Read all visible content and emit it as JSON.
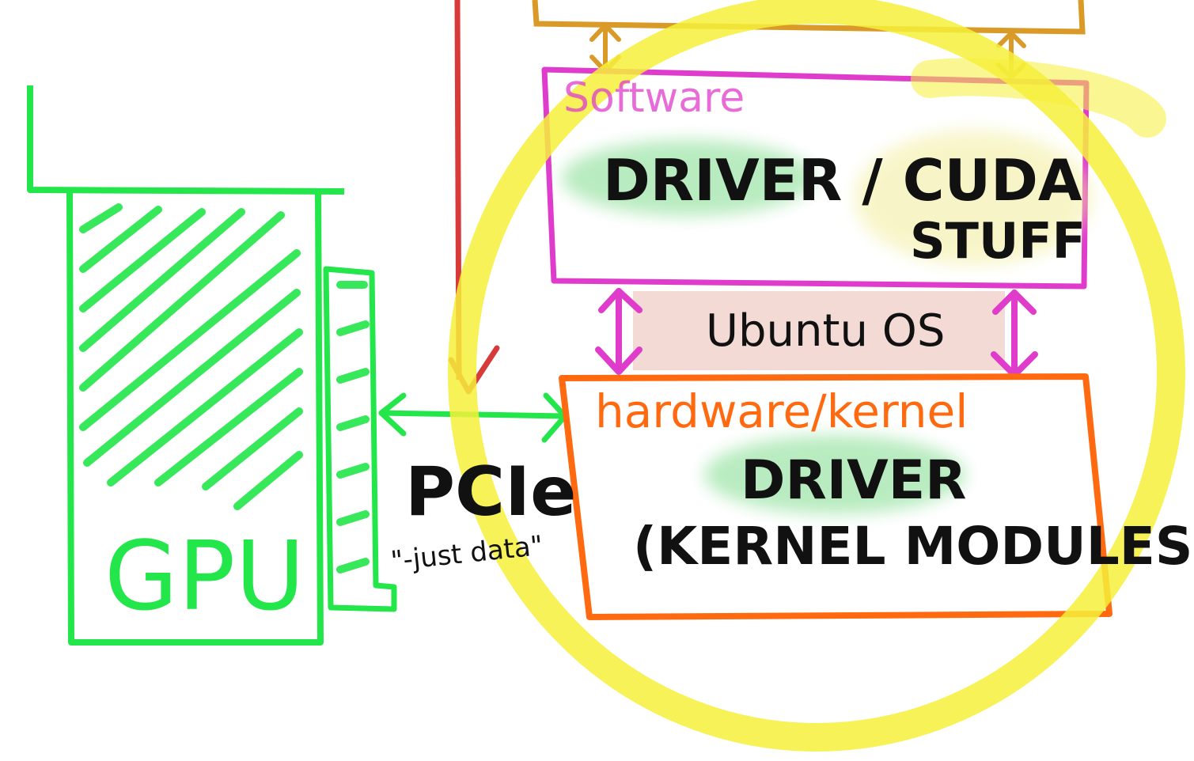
{
  "colors": {
    "gpu_green": "#22e64a",
    "yellow_highlight": "#f6f03a",
    "software_magenta": "#e03ccc",
    "hardware_orange": "#ff6a10",
    "top_box_gold": "#d99a28",
    "red_line": "#d83a3a",
    "os_band": "#f2d6cf",
    "ink": "#111111",
    "driver_highlight": "#7fdc8c"
  },
  "gpu": {
    "label": "GPU"
  },
  "bus": {
    "label": "PCIe",
    "note": "\"-just data\""
  },
  "software": {
    "label": "Software",
    "line1": "DRIVER / CUDA",
    "line2": "STUFF"
  },
  "os": {
    "label": "Ubuntu OS"
  },
  "hardware": {
    "label": "hardware/kernel",
    "line1": "DRIVER",
    "line2": "(KERNEL MODULES)"
  }
}
